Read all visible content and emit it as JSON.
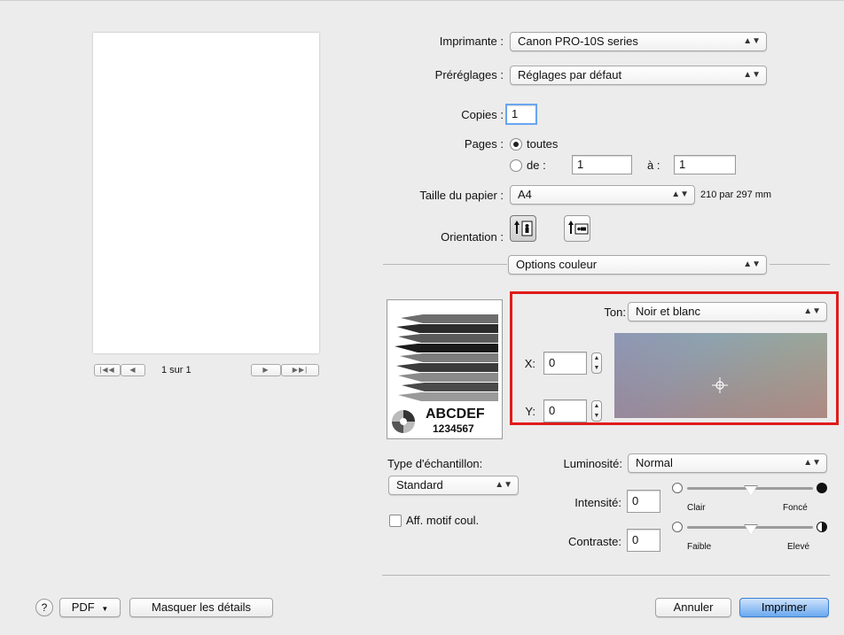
{
  "preview": {
    "page_label": "1 sur 1",
    "first_label": "|◀◀",
    "prev_label": "◀",
    "next_label": "▶",
    "last_label": "▶▶|"
  },
  "printer": {
    "label": "Imprimante :",
    "value": "Canon PRO-10S series"
  },
  "presets": {
    "label": "Préréglages :",
    "value": "Réglages par défaut"
  },
  "copies": {
    "label": "Copies :",
    "value": "1"
  },
  "pages": {
    "label": "Pages :",
    "all_label": "toutes",
    "from_label": "de :",
    "from_value": "1",
    "to_label": "à :",
    "to_value": "1"
  },
  "paper_size": {
    "label": "Taille du papier :",
    "value": "A4",
    "dimensions": "210 par 297 mm"
  },
  "orientation": {
    "label": "Orientation :"
  },
  "section": {
    "value": "Options couleur"
  },
  "tone": {
    "label": "Ton:",
    "value": "Noir et blanc"
  },
  "x": {
    "label": "X:",
    "value": "0"
  },
  "y": {
    "label": "Y:",
    "value": "0"
  },
  "sample": {
    "text1": "ABCDEF",
    "text2": "1234567"
  },
  "sample_type": {
    "label": "Type d'échantillon:",
    "value": "Standard"
  },
  "show_pattern": {
    "label": "Aff. motif coul."
  },
  "brightness": {
    "label": "Luminosité:",
    "value": "Normal"
  },
  "intensity": {
    "label": "Intensité:",
    "value": "0",
    "left": "Clair",
    "right": "Foncé"
  },
  "contrast": {
    "label": "Contraste:",
    "value": "0",
    "left": "Faible",
    "right": "Elevé"
  },
  "footer": {
    "help": "?",
    "pdf": "PDF",
    "hide_details": "Masquer les détails",
    "cancel": "Annuler",
    "print": "Imprimer"
  },
  "colors": {
    "highlight": "#e01b1b",
    "primary_button": "#6aa9f0"
  }
}
